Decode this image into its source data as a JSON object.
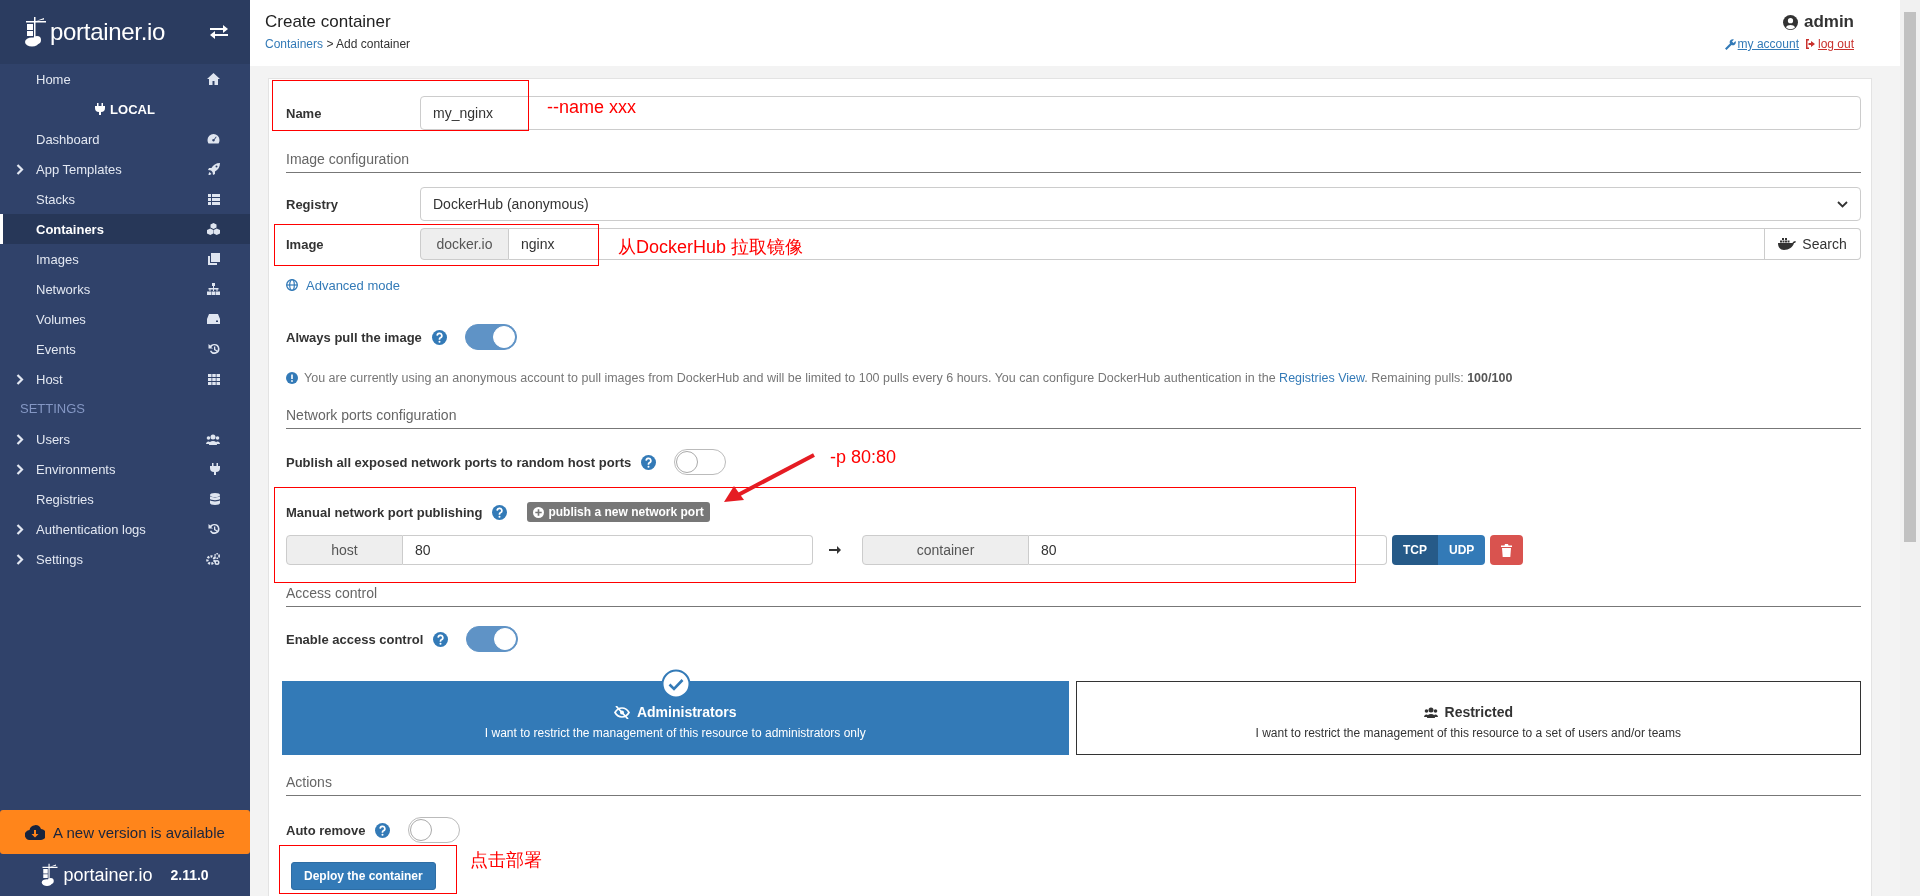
{
  "sidebar": {
    "logo": "portainer.io",
    "items": [
      {
        "label": "Home",
        "kind": "link",
        "expandable": false,
        "selected": false
      },
      {
        "label": "LOCAL",
        "kind": "environment"
      },
      {
        "label": "Dashboard",
        "kind": "link",
        "expandable": false,
        "selected": false
      },
      {
        "label": "App Templates",
        "kind": "link",
        "expandable": true,
        "selected": false
      },
      {
        "label": "Stacks",
        "kind": "link",
        "expandable": false,
        "selected": false
      },
      {
        "label": "Containers",
        "kind": "link",
        "expandable": false,
        "selected": true
      },
      {
        "label": "Images",
        "kind": "link",
        "expandable": false,
        "selected": false
      },
      {
        "label": "Networks",
        "kind": "link",
        "expandable": false,
        "selected": false
      },
      {
        "label": "Volumes",
        "kind": "link",
        "expandable": false,
        "selected": false
      },
      {
        "label": "Events",
        "kind": "link",
        "expandable": false,
        "selected": false
      },
      {
        "label": "Host",
        "kind": "link",
        "expandable": true,
        "selected": false
      },
      {
        "label": "SETTINGS",
        "kind": "section"
      },
      {
        "label": "Users",
        "kind": "link",
        "expandable": true,
        "selected": false
      },
      {
        "label": "Environments",
        "kind": "link",
        "expandable": true,
        "selected": false
      },
      {
        "label": "Registries",
        "kind": "link",
        "expandable": false,
        "selected": false
      },
      {
        "label": "Authentication logs",
        "kind": "link",
        "expandable": true,
        "selected": false
      },
      {
        "label": "Settings",
        "kind": "link",
        "expandable": true,
        "selected": false
      }
    ],
    "update_banner": "A new version is available",
    "footer": {
      "logo": "portainer.io",
      "version": "2.11.0"
    }
  },
  "header": {
    "title": "Create container",
    "breadcrumb": [
      {
        "label": "Containers",
        "link": true
      },
      {
        "label": "Add container",
        "link": false
      }
    ],
    "breadcrumb_separator": ">",
    "user": "admin",
    "my_account": "my account",
    "log_out": "log out"
  },
  "name_field": {
    "label": "Name",
    "value": "my_nginx"
  },
  "image_configuration": {
    "heading": "Image configuration",
    "registry": {
      "label": "Registry",
      "value": "DockerHub (anonymous)"
    },
    "image": {
      "label": "Image",
      "prefix": "docker.io",
      "value": "nginx",
      "search_button": "Search"
    },
    "advanced_mode": "Advanced mode",
    "always_pull": {
      "label": "Always pull the image",
      "on": true
    },
    "notice": {
      "text_before": "You are currently using an anonymous account to pull images from DockerHub and will be limited to 100 pulls every 6 hours. You can configure DockerHub authentication in the ",
      "link": "Registries View",
      "text_after": ". Remaining pulls: **100/100**"
    }
  },
  "network_ports": {
    "heading": "Network ports configuration",
    "publish_all": {
      "label": "Publish all exposed network ports to random host ports",
      "on": false
    },
    "manual": {
      "label": "Manual network port publishing",
      "add_button": "publish a new network port"
    },
    "ports": [
      {
        "host_label": "host",
        "host_value": "80",
        "container_label": "container",
        "container_value": "80",
        "protocols": [
          {
            "label": "TCP",
            "selected": true
          },
          {
            "label": "UDP",
            "selected": false
          }
        ]
      }
    ]
  },
  "access_control": {
    "heading": "Access control",
    "enable": {
      "label": "Enable access control",
      "on": true
    },
    "options": [
      {
        "title": "Administrators",
        "description": "I want to restrict the management of this resource to administrators only",
        "selected": true
      },
      {
        "title": "Restricted",
        "description": "I want to restrict the management of this resource to a set of users and/or teams",
        "selected": false
      }
    ]
  },
  "actions": {
    "heading": "Actions",
    "auto_remove": {
      "label": "Auto remove",
      "on": false
    },
    "deploy_button": "Deploy the container"
  },
  "annotations": [
    {
      "text": "--name xxx"
    },
    {
      "text": "从DockerHub 拉取镜像"
    },
    {
      "text": "-p 80:80"
    },
    {
      "text": "点击部署"
    }
  ]
}
